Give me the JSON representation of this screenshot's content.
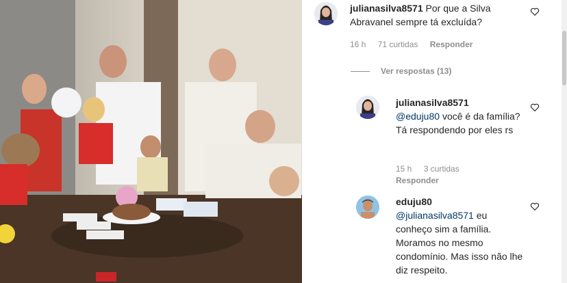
{
  "comments": [
    {
      "user": "julianasilva8571",
      "text": "Por que a Silva Abravanel sempre tá excluída?",
      "time": "16 h",
      "likes": "71 curtidas",
      "reply": "Responder"
    },
    {
      "user": "julianasilva8571",
      "mention": "@eduju80",
      "text": "você é da família? Tá respondendo por eles rs",
      "time": "15 h",
      "likes": "3 curtidas",
      "reply": "Responder"
    },
    {
      "user": "eduju80",
      "mention": "@julianasilva8571",
      "text": "eu conheço sim a família. Moramos no mesmo condomínio. Mas isso não lhe diz respeito.",
      "time": "",
      "likes": "",
      "reply": ""
    }
  ],
  "view_replies": "Ver respostas (13)",
  "colors": {
    "mention": "#00376b",
    "meta": "#8e8e8e"
  }
}
